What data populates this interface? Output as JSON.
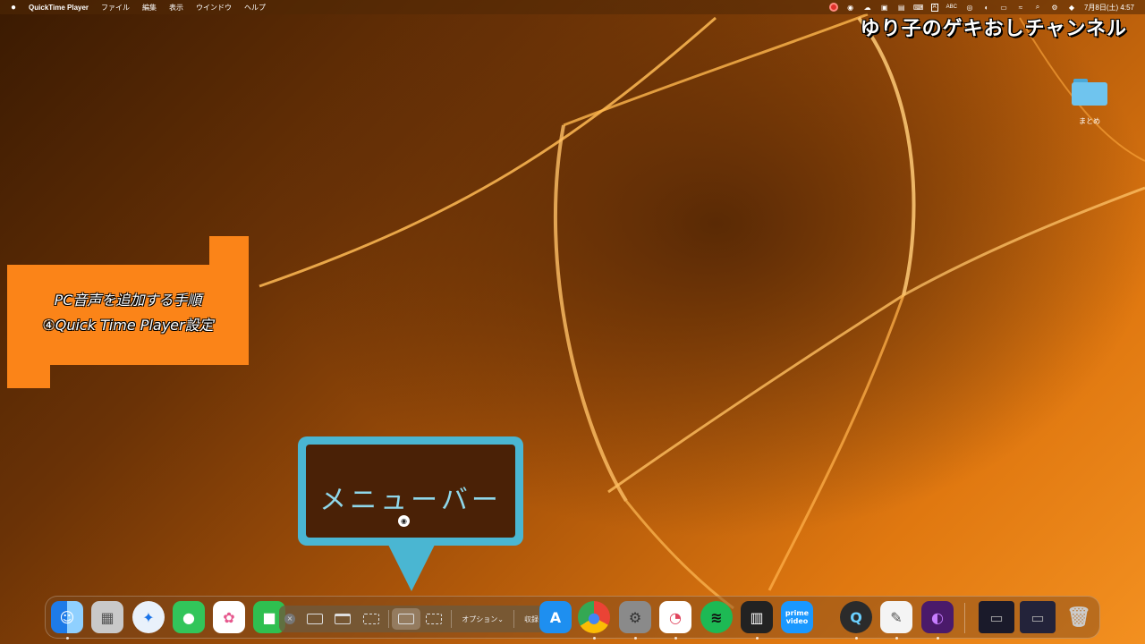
{
  "menubar": {
    "apple": "",
    "app_name": "QuickTime Player",
    "menus": [
      "ファイル",
      "編集",
      "表示",
      "ウインドウ",
      "ヘルプ"
    ],
    "abc": "ABC",
    "clock": "7月8日(土) 4:57"
  },
  "overlay": {
    "channel_title": "ゆり子のゲキおしチャンネル",
    "note_line1": "PC音声を追加する手順",
    "note_line2": "④Quick Time Player設定",
    "callout_label": "メニューバー"
  },
  "desktop": {
    "folder_label": "まとめ"
  },
  "screenshot_toolbar": {
    "options_label": "オプション⌄",
    "record_label": "収録"
  },
  "dock": {
    "items": [
      "finder-icon",
      "launchpad-icon",
      "safari-icon",
      "messages-icon",
      "photos-icon",
      "facetime-icon",
      "appstore-icon",
      "chrome-icon",
      "system-settings-icon",
      "music-app-icon",
      "spotify-icon",
      "piano-icon",
      "prime-video-icon",
      "quicktime-icon",
      "textedit-icon",
      "editor-app-icon",
      "trash-icon"
    ],
    "prime_video_label": "prime video"
  }
}
